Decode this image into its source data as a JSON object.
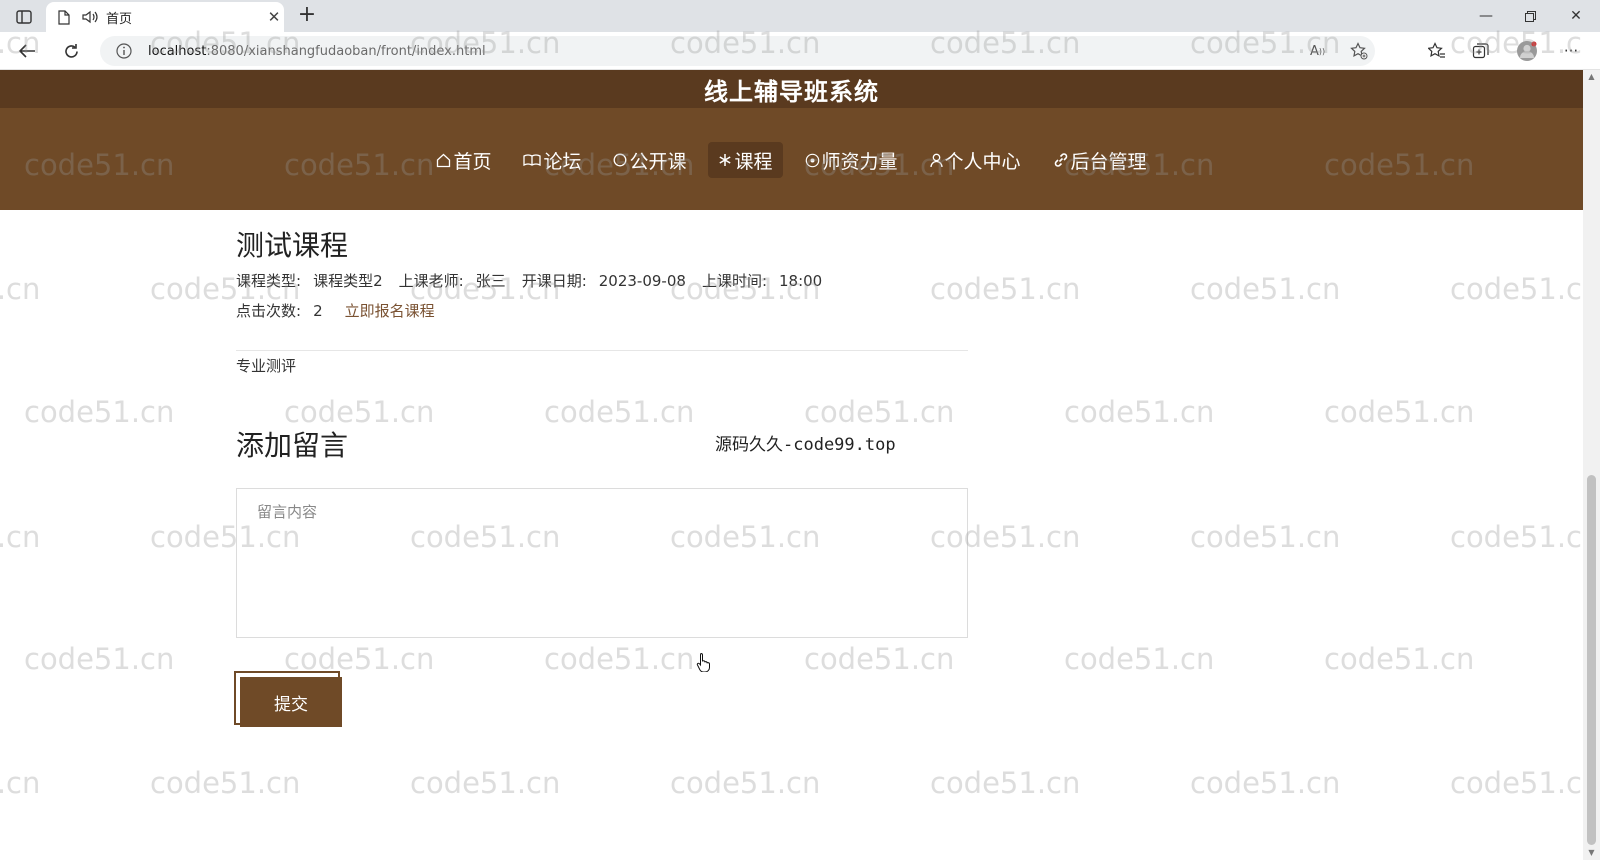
{
  "browser": {
    "tab_title": "首页",
    "url_host": "localhost",
    "url_rest": ":8080/xianshangfudaoban/front/index.html"
  },
  "site": {
    "title": "线上辅导班系统",
    "nav": [
      {
        "label": "首页",
        "icon": "home-icon",
        "active": false
      },
      {
        "label": "论坛",
        "icon": "book-icon",
        "active": false
      },
      {
        "label": "公开课",
        "icon": "circle-icon",
        "active": false
      },
      {
        "label": "课程",
        "icon": "snowflake-icon",
        "active": true
      },
      {
        "label": "师资力量",
        "icon": "target-icon",
        "active": false
      },
      {
        "label": "个人中心",
        "icon": "user-icon",
        "active": false
      },
      {
        "label": "后台管理",
        "icon": "link-icon",
        "active": false
      }
    ]
  },
  "course": {
    "title": "测试课程",
    "type_label": "课程类型:",
    "type_value": "课程类型2",
    "teacher_label": "上课老师:",
    "teacher_value": "张三",
    "start_date_label": "开课日期:",
    "start_date_value": "2023-09-08",
    "time_label": "上课时间:",
    "time_value": "18:00",
    "clicks_label": "点击次数:",
    "clicks_value": "2",
    "enroll_link": "立即报名课程",
    "description": "专业测评"
  },
  "comment": {
    "heading": "添加留言",
    "placeholder": "留言内容",
    "value": "",
    "submit_label": "提交"
  },
  "overlay": {
    "source_note": "源码久久-code99.top",
    "watermark": "code51.cn"
  },
  "colors": {
    "header_bg": "#6f4a27",
    "title_bar_bg": "#5a3a1f",
    "accent": "#7a5232"
  }
}
